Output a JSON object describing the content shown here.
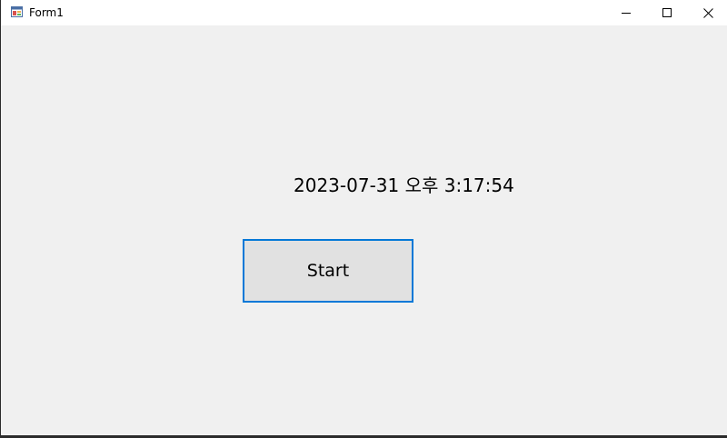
{
  "window": {
    "title": "Form1",
    "icon": "winforms-app-icon",
    "controls": {
      "minimize": "minimize-icon",
      "maximize": "maximize-icon",
      "close": "close-icon"
    }
  },
  "main": {
    "time_label": "2023-07-31 오후 3:17:54",
    "start_button_label": "Start"
  },
  "colors": {
    "titlebar_bg": "#ffffff",
    "client_bg": "#f0f0f0",
    "button_bg": "#e1e1e1",
    "button_focus_border": "#0078d7"
  }
}
